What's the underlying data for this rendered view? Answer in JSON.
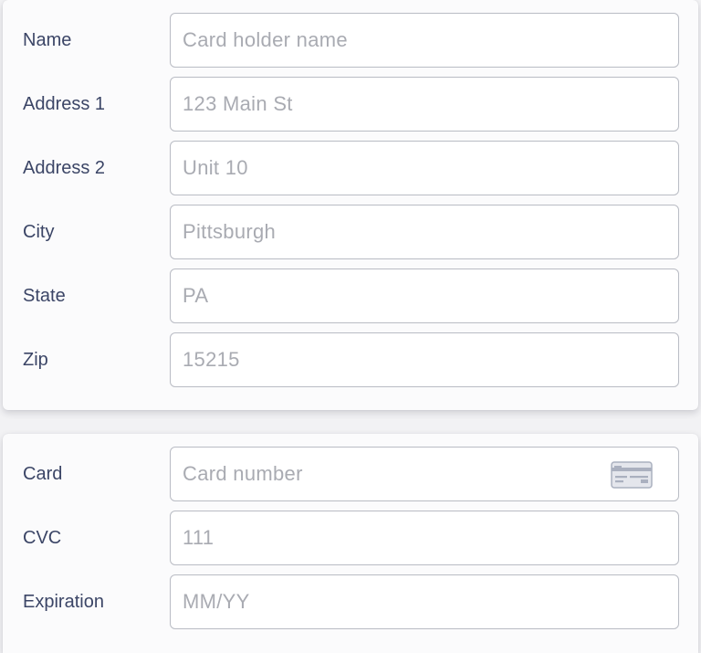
{
  "address": {
    "fields": [
      {
        "label": "Name",
        "placeholder": "Card holder name",
        "value": ""
      },
      {
        "label": "Address 1",
        "placeholder": "123 Main St",
        "value": ""
      },
      {
        "label": "Address 2",
        "placeholder": "Unit 10",
        "value": ""
      },
      {
        "label": "City",
        "placeholder": "Pittsburgh",
        "value": ""
      },
      {
        "label": "State",
        "placeholder": "PA",
        "value": ""
      },
      {
        "label": "Zip",
        "placeholder": "15215",
        "value": ""
      }
    ]
  },
  "card": {
    "fields": [
      {
        "label": "Card",
        "placeholder": "Card number",
        "value": "",
        "icon": "credit-card-icon"
      },
      {
        "label": "CVC",
        "placeholder": "111",
        "value": ""
      },
      {
        "label": "Expiration",
        "placeholder": "MM/YY",
        "value": ""
      }
    ]
  },
  "colors": {
    "label": "#3b4566",
    "placeholder": "#a9abb2",
    "border": "#b9bcc4",
    "panel": "#fbfbfc",
    "background": "#f2f2f4"
  }
}
